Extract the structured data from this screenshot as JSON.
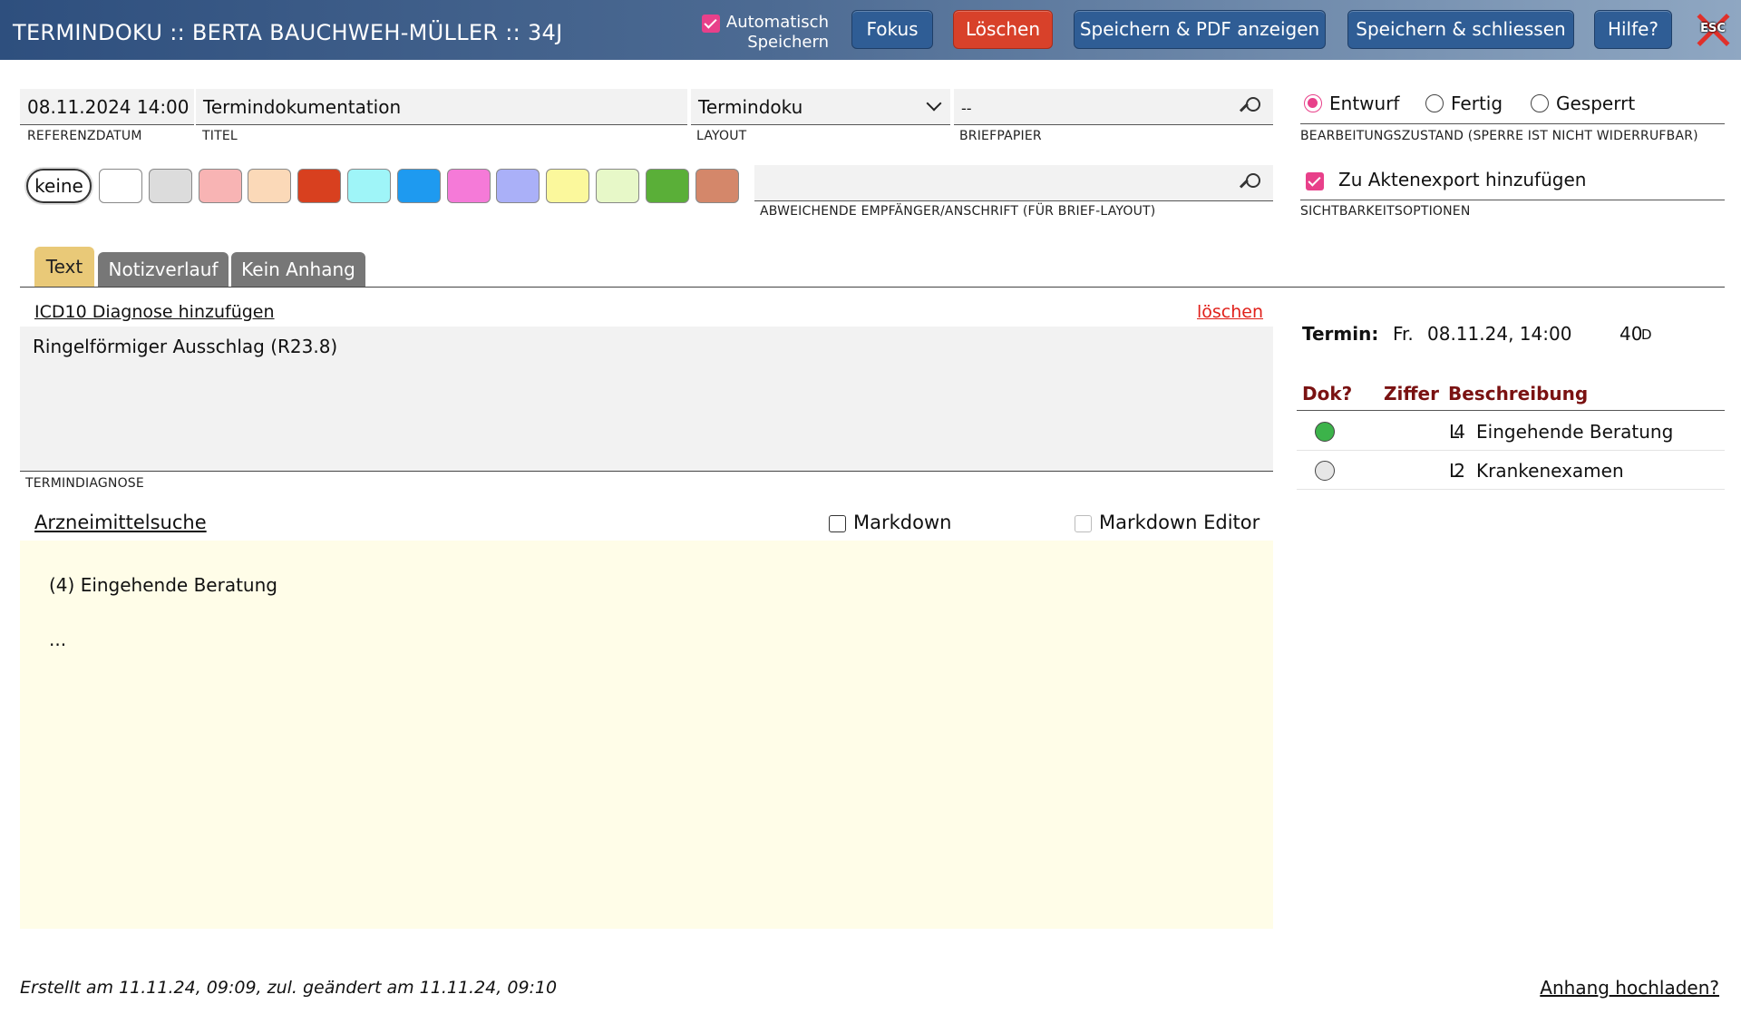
{
  "header": {
    "title": "TERMINDOKU :: BERTA BAUCHWEH-MÜLLER :: 34J",
    "autosave_line1": "Automatisch",
    "autosave_line2": "Speichern",
    "buttons": {
      "fokus": "Fokus",
      "loeschen": "Löschen",
      "save_pdf": "Speichern & PDF anzeigen",
      "save_close": "Speichern & schliessen",
      "help": "Hilfe?",
      "esc": "ESC"
    },
    "colors": {
      "primary_button": "#2f5d95",
      "danger_button": "#d8412a",
      "accent": "#e8408a"
    }
  },
  "form": {
    "referenzdatum": {
      "value": "08.11.2024 14:00",
      "label": "REFERENZDATUM"
    },
    "titel": {
      "value": "Termindokumentation",
      "label": "TITEL"
    },
    "layout": {
      "value": "Termindoku",
      "label": "LAYOUT"
    },
    "briefpapier": {
      "value": "--",
      "label": "BRIEFPAPIER"
    },
    "empfaenger": {
      "value": "",
      "label": "ABWEICHENDE EMPFÄNGER/ANSCHRIFT (FÜR BRIEF-LAYOUT)"
    },
    "status": {
      "label": "BEARBEITUNGSZUSTAND (SPERRE IST NICHT WIDERRUFBAR)",
      "options": [
        "Entwurf",
        "Fertig",
        "Gesperrt"
      ],
      "selected": "Entwurf"
    },
    "sichtbarkeit": {
      "checkbox_label": "Zu Aktenexport hinzufügen",
      "label": "SICHTBARKEITSOPTIONEN",
      "checked": true
    }
  },
  "colors_picker": {
    "none_label": "keine",
    "swatches": [
      "#ffffff",
      "#dcdcdc",
      "#f8b4b4",
      "#fbd9b8",
      "#d8401f",
      "#9ff5f8",
      "#1e9af0",
      "#f57ad8",
      "#aab0f8",
      "#fbf89c",
      "#e7f8c8",
      "#5aaf38",
      "#d4876a"
    ]
  },
  "tabs": [
    "Text",
    "Notizverlauf",
    "Kein Anhang"
  ],
  "diagnosis": {
    "add_link": "ICD10 Diagnose hinzufügen",
    "delete_link": "löschen",
    "text": "Ringelförmiger Ausschlag (R23.8)",
    "label": "TERMINDIAGNOSE"
  },
  "editor": {
    "drug_search": "Arzneimittelsuche",
    "markdown": "Markdown",
    "markdown_editor": "Markdown Editor",
    "lines": [
      "(4) Eingehende Beratung",
      "",
      "..."
    ]
  },
  "termin": {
    "label": "Termin:",
    "day": "Fr.",
    "datetime": "08.11.24, 14:00",
    "duration": "40",
    "duration_unit": "D"
  },
  "table": {
    "headers": {
      "dok": "Dok?",
      "ziffer": "Ziffer",
      "beschreibung": "Beschreibung"
    },
    "rows": [
      {
        "ziffer": "4",
        "type": "L",
        "beschreibung": "Eingehende Beratung",
        "status_color": "#3cb34a"
      },
      {
        "ziffer": "2",
        "type": "L",
        "beschreibung": "Krankenexamen",
        "status_color": "#e6e6e6"
      }
    ]
  },
  "footer": {
    "info": "Erstellt am 11.11.24, 09:09, zul. geändert am 11.11.24, 09:10",
    "upload_link": "Anhang hochladen?"
  }
}
